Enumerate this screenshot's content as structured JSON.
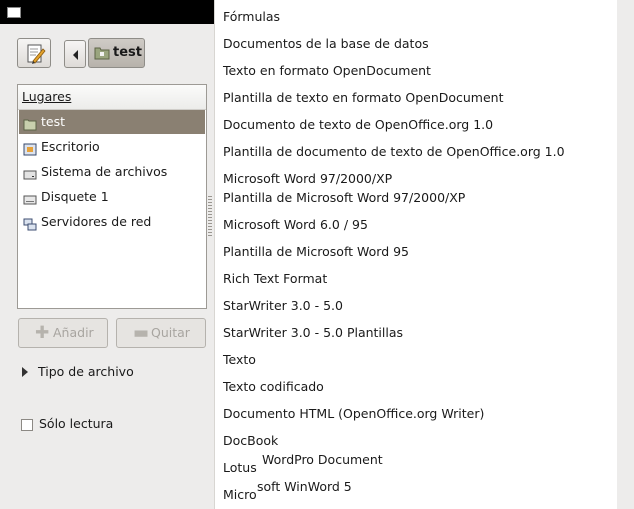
{
  "titlebar": {
    "close_glyph": "✕"
  },
  "toolbar": {
    "path_button_label": "test"
  },
  "places": {
    "header": "Lugares",
    "items": [
      {
        "label": "test",
        "icon": "folder-icon",
        "selected": true
      },
      {
        "label": "Escritorio",
        "icon": "desktop-icon",
        "selected": false
      },
      {
        "label": "Sistema de archivos",
        "icon": "harddisk-icon",
        "selected": false
      },
      {
        "label": "Disquete 1",
        "icon": "floppy-icon",
        "selected": false
      },
      {
        "label": "Servidores de red",
        "icon": "network-icon",
        "selected": false
      }
    ]
  },
  "buttons": {
    "add_label": "Añadir",
    "remove_label": "Quitar"
  },
  "file_type": {
    "label": "Tipo de archivo"
  },
  "readonly": {
    "label": "Sólo lectura",
    "checked": false
  },
  "menu": {
    "items": [
      "Fórmulas",
      "Documentos de la base de datos",
      "Texto en formato OpenDocument",
      "Plantilla de texto en formato OpenDocument",
      "Documento de texto de OpenOffice.org 1.0",
      "Plantilla de documento de texto de OpenOffice.org 1.0",
      "Microsoft Word 97/2000/XP",
      "Plantilla de Microsoft Word 97/2000/XP",
      "Microsoft Word 6.0 / 95",
      "Plantilla de Microsoft Word 95",
      "Rich Text Format",
      "StarWriter 3.0 - 5.0",
      "StarWriter 3.0 - 5.0 Plantillas",
      "Texto",
      "Texto codificado",
      "Documento HTML (OpenOffice.org Writer)",
      "DocBook"
    ],
    "glitch": {
      "lotus_a": "Lotus",
      "lotus_b": "WordPro Document",
      "winword_a": "Micro",
      "winword_b": "soft WinWord 5"
    }
  }
}
